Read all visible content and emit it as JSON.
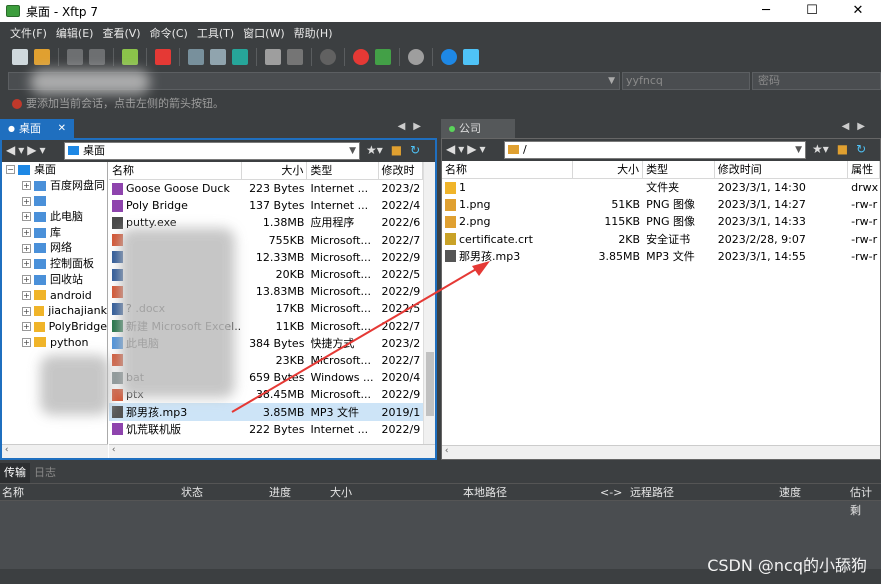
{
  "window": {
    "title": "桌面 - Xftp 7",
    "minimize": "─",
    "maximize": "☐",
    "close": "✕"
  },
  "menu": [
    "文件(F)",
    "编辑(E)",
    "查看(V)",
    "命令(C)",
    "工具(T)",
    "窗口(W)",
    "帮助(H)"
  ],
  "address": {
    "host_value": "",
    "user_placeholder": "yyfncq",
    "password_placeholder": "密码"
  },
  "hint": "要添加当前会话，点击左侧的箭头按钮。",
  "left_pane": {
    "tab": "桌面",
    "path": "桌面",
    "tree": [
      {
        "label": "桌面",
        "level": 0
      },
      {
        "label": "百度网盘同",
        "level": 1
      },
      {
        "label": "",
        "level": 1
      },
      {
        "label": "此电脑",
        "level": 1
      },
      {
        "label": "库",
        "level": 1
      },
      {
        "label": "网络",
        "level": 1
      },
      {
        "label": "控制面板",
        "level": 1
      },
      {
        "label": "回收站",
        "level": 1
      },
      {
        "label": "android",
        "level": 1
      },
      {
        "label": "jiachajiank",
        "level": 1
      },
      {
        "label": "PolyBridge",
        "level": 1
      },
      {
        "label": "python",
        "level": 1
      }
    ],
    "columns": [
      "名称",
      "大小",
      "类型",
      "修改时"
    ],
    "files": [
      {
        "name": "Goose Goose Duck",
        "size": "223 Bytes",
        "type": "Internet ...",
        "date": "2023/2",
        "icon": "web-shortcut-icon"
      },
      {
        "name": "Poly Bridge",
        "size": "137 Bytes",
        "type": "Internet ...",
        "date": "2022/4",
        "icon": "web-shortcut-icon"
      },
      {
        "name": "putty.exe",
        "size": "1.38MB",
        "type": "应用程序",
        "date": "2022/6",
        "icon": "exe-icon"
      },
      {
        "name": "",
        "size": "755KB",
        "type": "Microsoft...",
        "date": "2022/7",
        "icon": "ppt-icon"
      },
      {
        "name": "",
        "size": "12.33MB",
        "type": "Microsoft...",
        "date": "2022/9",
        "icon": "word-icon"
      },
      {
        "name": "",
        "size": "20KB",
        "type": "Microsoft...",
        "date": "2022/5",
        "icon": "word-icon"
      },
      {
        "name": "",
        "size": "13.83MB",
        "type": "Microsoft...",
        "date": "2022/9",
        "icon": "ppt-icon"
      },
      {
        "name": "? .docx",
        "size": "17KB",
        "type": "Microsoft...",
        "date": "2022/5",
        "icon": "word-icon"
      },
      {
        "name": "新建 Microsoft Excel...",
        "size": "11KB",
        "type": "Microsoft...",
        "date": "2022/7",
        "icon": "excel-icon"
      },
      {
        "name": "此电脑",
        "size": "384 Bytes",
        "type": "快捷方式",
        "date": "2023/2",
        "icon": "shortcut-icon"
      },
      {
        "name": "",
        "size": "23KB",
        "type": "Microsoft...",
        "date": "2022/7",
        "icon": "ppt-icon"
      },
      {
        "name": "bat",
        "size": "659 Bytes",
        "type": "Windows ...",
        "date": "2020/4",
        "icon": "bat-icon"
      },
      {
        "name": "ptx",
        "size": "38.45MB",
        "type": "Microsoft...",
        "date": "2022/9",
        "icon": "ppt-icon"
      },
      {
        "name": "那男孩.mp3",
        "size": "3.85MB",
        "type": "MP3 文件",
        "date": "2019/1",
        "icon": "mp3-icon",
        "selected": true
      },
      {
        "name": "饥荒联机版",
        "size": "222 Bytes",
        "type": "Internet ...",
        "date": "2022/9",
        "icon": "web-shortcut-icon"
      }
    ]
  },
  "right_pane": {
    "tab": "公司",
    "path": "/",
    "columns": [
      "名称",
      "大小",
      "类型",
      "修改时间",
      "属性"
    ],
    "files": [
      {
        "name": "1",
        "size": "",
        "type": "文件夹",
        "date": "2023/3/1, 14:30",
        "attr": "drwx",
        "icon": "folder-icon"
      },
      {
        "name": "1.png",
        "size": "51KB",
        "type": "PNG 图像",
        "date": "2023/3/1, 14:27",
        "attr": "-rw-r",
        "icon": "png-icon"
      },
      {
        "name": "2.png",
        "size": "115KB",
        "type": "PNG 图像",
        "date": "2023/3/1, 14:33",
        "attr": "-rw-r",
        "icon": "png-icon"
      },
      {
        "name": "certificate.crt",
        "size": "2KB",
        "type": "安全证书",
        "date": "2023/2/28, 9:07",
        "attr": "-rw-r",
        "icon": "cert-icon"
      },
      {
        "name": "那男孩.mp3",
        "size": "3.85MB",
        "type": "MP3 文件",
        "date": "2023/3/1, 14:55",
        "attr": "-rw-r",
        "icon": "mp3-icon"
      }
    ]
  },
  "transfer": {
    "tabs": [
      "传输",
      "日志"
    ],
    "columns": [
      "名称",
      "状态",
      "进度",
      "大小",
      "本地路径",
      "<->",
      "远程路径",
      "速度",
      "估计剩"
    ]
  },
  "watermark": "CSDN @ncq的小舔狗",
  "colors": {
    "accent": "#1f6fbf",
    "arrow": "#e53935",
    "selection": "#cde4f7",
    "chrome": "#3c3f41"
  }
}
